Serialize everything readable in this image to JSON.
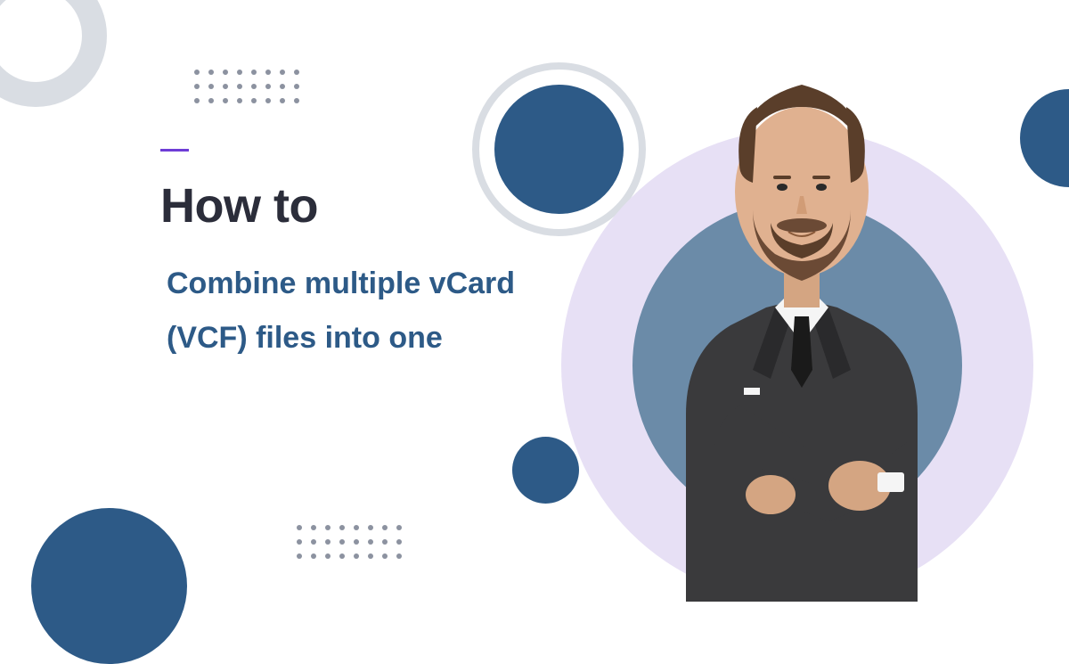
{
  "heading": "How to",
  "subheading_line1": "Combine multiple vCard",
  "subheading_line2": "(VCF) files into one",
  "colors": {
    "primary_blue": "#2d5a87",
    "accent_purple": "#6e3dd6",
    "lilac_bg": "#e7e0f5",
    "slate_circle": "#6b8ba8",
    "light_gray": "#d9dde3",
    "dot_gray": "#8c92a0",
    "heading_color": "#2b2d3a"
  }
}
